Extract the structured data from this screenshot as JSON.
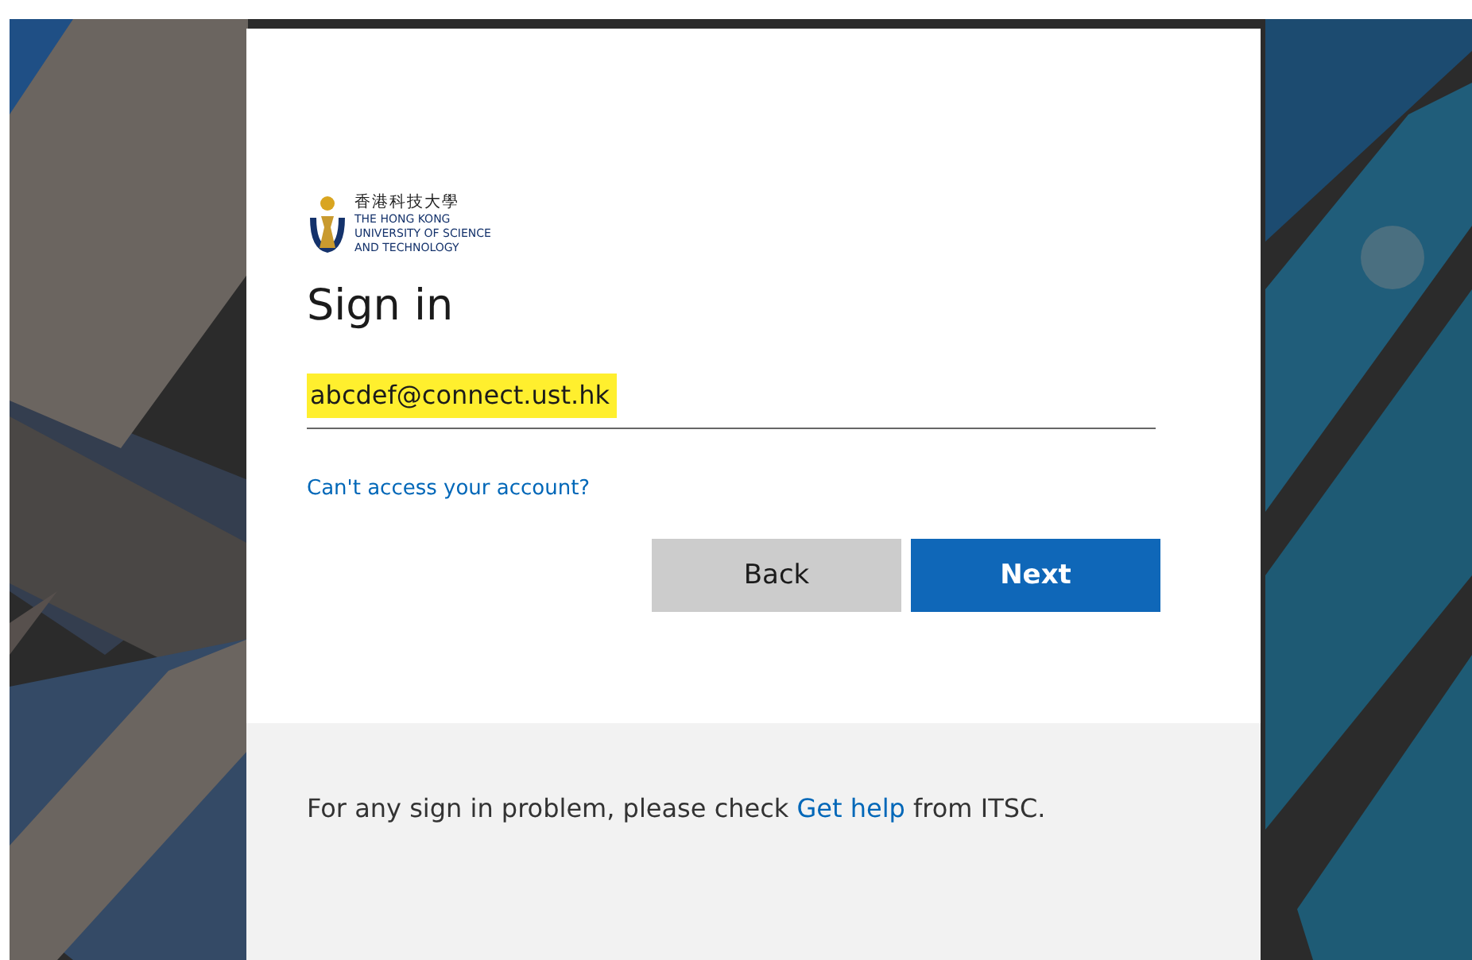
{
  "logo": {
    "chinese_name": "香港科技大學",
    "lines": [
      "THE HONG KONG",
      "UNIVERSITY OF SCIENCE",
      "AND TECHNOLOGY"
    ]
  },
  "title": "Sign in",
  "email_field": {
    "value": "abcdef@connect.ust.hk",
    "highlighted": true
  },
  "help_link": "Can't access your account?",
  "buttons": [
    {
      "label": "Back",
      "kind": "secondary"
    },
    {
      "label": "Next",
      "kind": "primary"
    }
  ],
  "footer": {
    "text_before": "For any sign in problem, please check ",
    "link": "Get help",
    "text_after": " from ITSC."
  }
}
